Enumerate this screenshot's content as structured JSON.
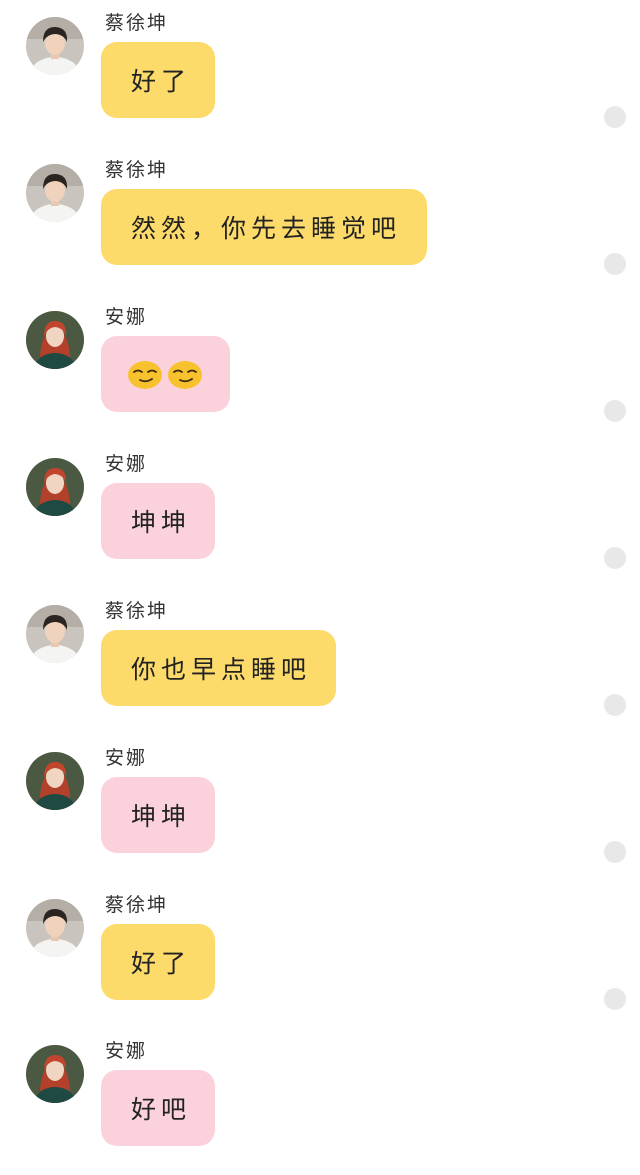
{
  "colors": {
    "kun_bubble": "#fcdb6a",
    "anna_bubble": "#fbd2dc",
    "status_dot": "#e8e8e8"
  },
  "messages": [
    {
      "sender": "蔡徐坤",
      "text": "好了",
      "avatar": "male-avatar",
      "bubble": "yellow"
    },
    {
      "sender": "蔡徐坤",
      "text": "然然，你先去睡觉吧",
      "avatar": "male-avatar",
      "bubble": "yellow"
    },
    {
      "sender": "安娜",
      "text": "",
      "emojis": [
        "smirk-emoji",
        "smirk-emoji"
      ],
      "avatar": "female-avatar",
      "bubble": "pink"
    },
    {
      "sender": "安娜",
      "text": "坤坤",
      "avatar": "female-avatar",
      "bubble": "pink"
    },
    {
      "sender": "蔡徐坤",
      "text": "你也早点睡吧",
      "avatar": "male-avatar",
      "bubble": "yellow"
    },
    {
      "sender": "安娜",
      "text": "坤坤",
      "avatar": "female-avatar",
      "bubble": "pink"
    },
    {
      "sender": "蔡徐坤",
      "text": "好了",
      "avatar": "male-avatar",
      "bubble": "yellow"
    },
    {
      "sender": "安娜",
      "text": "好吧",
      "avatar": "female-avatar",
      "bubble": "pink"
    }
  ]
}
